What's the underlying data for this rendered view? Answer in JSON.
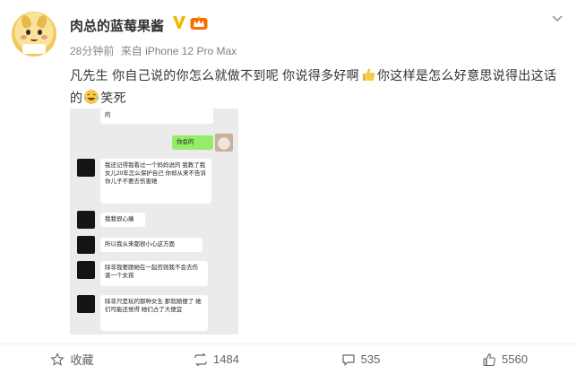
{
  "post": {
    "username": "肉总的蓝莓果酱",
    "time": "28分钟前",
    "source_prefix": "来自",
    "device": "iPhone 12 Pro Max",
    "text_part1": "凡先生 你自己说的你怎么就做不到呢 你说得多好啊",
    "text_part2": "你这样是怎么好意思说得出这话的",
    "text_part3": "笑死"
  },
  "screenshot": {
    "messages": [
      {
        "side": "left",
        "text": "的"
      },
      {
        "side": "right",
        "text": "你会的"
      },
      {
        "side": "left",
        "text": "我还记得我看过一个妈妈说的 我教了我女儿20年怎么保护自己 你却从来不告诉你儿子不要去伤害她"
      },
      {
        "side": "left",
        "text": "我我很心痛"
      },
      {
        "side": "left",
        "text": "所以我从来都很小心这方面"
      },
      {
        "side": "left",
        "text": "除非我要跟她在一起否则我不会去伤害一个女孩"
      },
      {
        "side": "left",
        "text": "除非只是玩的那种女生 那就随便了 她们可能还觉得 她们占了大便宜"
      }
    ]
  },
  "actions": {
    "favorite": "收藏",
    "repost": "1484",
    "comment": "535",
    "like": "5560"
  },
  "icons": {
    "verified": "v-badge-icon",
    "member": "member-badge-icon",
    "menu": "chevron-down-icon",
    "emoji_thumbs": "thumbs-up-emoji",
    "emoji_laugh": "laughing-tears-emoji"
  },
  "colors": {
    "verified": "#f7b500",
    "member": "#ff6a00",
    "bubble_green": "#95ec69",
    "text": "#333333",
    "muted": "#888888"
  }
}
